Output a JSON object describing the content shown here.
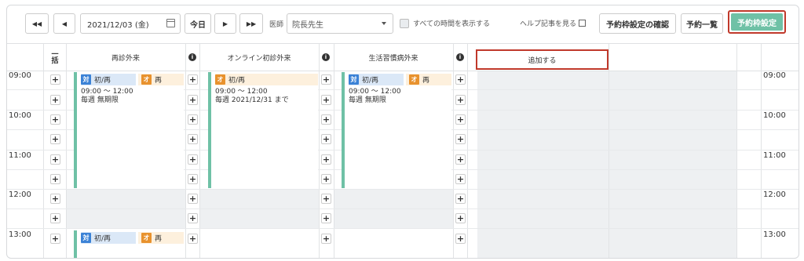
{
  "toolbar": {
    "prev_week": "◀◀",
    "prev_day": "◀",
    "date": "2021/12/03 (金)",
    "today": "今日",
    "next_day": "▶",
    "next_week": "▶▶",
    "doctor_label": "医師",
    "doctor_value": "院長先生",
    "show_all_label": "すべての時間を表示する",
    "help_label": "ヘルプ記事を見る",
    "confirm_label": "予約枠設定の確認",
    "list_label": "予約一覧",
    "settings_label": "予約枠設定"
  },
  "columns": [
    {
      "name": "再診外来"
    },
    {
      "name": "オンライン初診外来"
    },
    {
      "name": "生活習慣病外来"
    }
  ],
  "collapse_label": "一\n括",
  "add_label": "追加する",
  "times": [
    "09:00",
    "10:00",
    "11:00",
    "12:00",
    "13:00"
  ],
  "cards": [
    {
      "tag1_icon": "対",
      "tag1_text": "初/再",
      "tag2_icon": "オ",
      "tag2_text": "再",
      "time": "09:00 ～ 12:00",
      "repeat": "毎週 無期限"
    },
    {
      "tag1_icon": "オ",
      "tag1_text": "初/再",
      "time": "09:00 ～ 12:00",
      "repeat": "毎週 2021/12/31 まで"
    },
    {
      "tag1_icon": "対",
      "tag1_text": "初/再",
      "tag2_icon": "オ",
      "tag2_text": "再",
      "time": "09:00 ～ 12:00",
      "repeat": "毎週 無期限"
    },
    {
      "tag1_icon": "対",
      "tag1_text": "初/再",
      "tag2_icon": "オ",
      "tag2_text": "再"
    }
  ],
  "colors": {
    "accent": "#6fc1a6",
    "highlight": "#c0392b",
    "blue_tag": "#3b82d6",
    "orange_tag": "#e8922e"
  }
}
